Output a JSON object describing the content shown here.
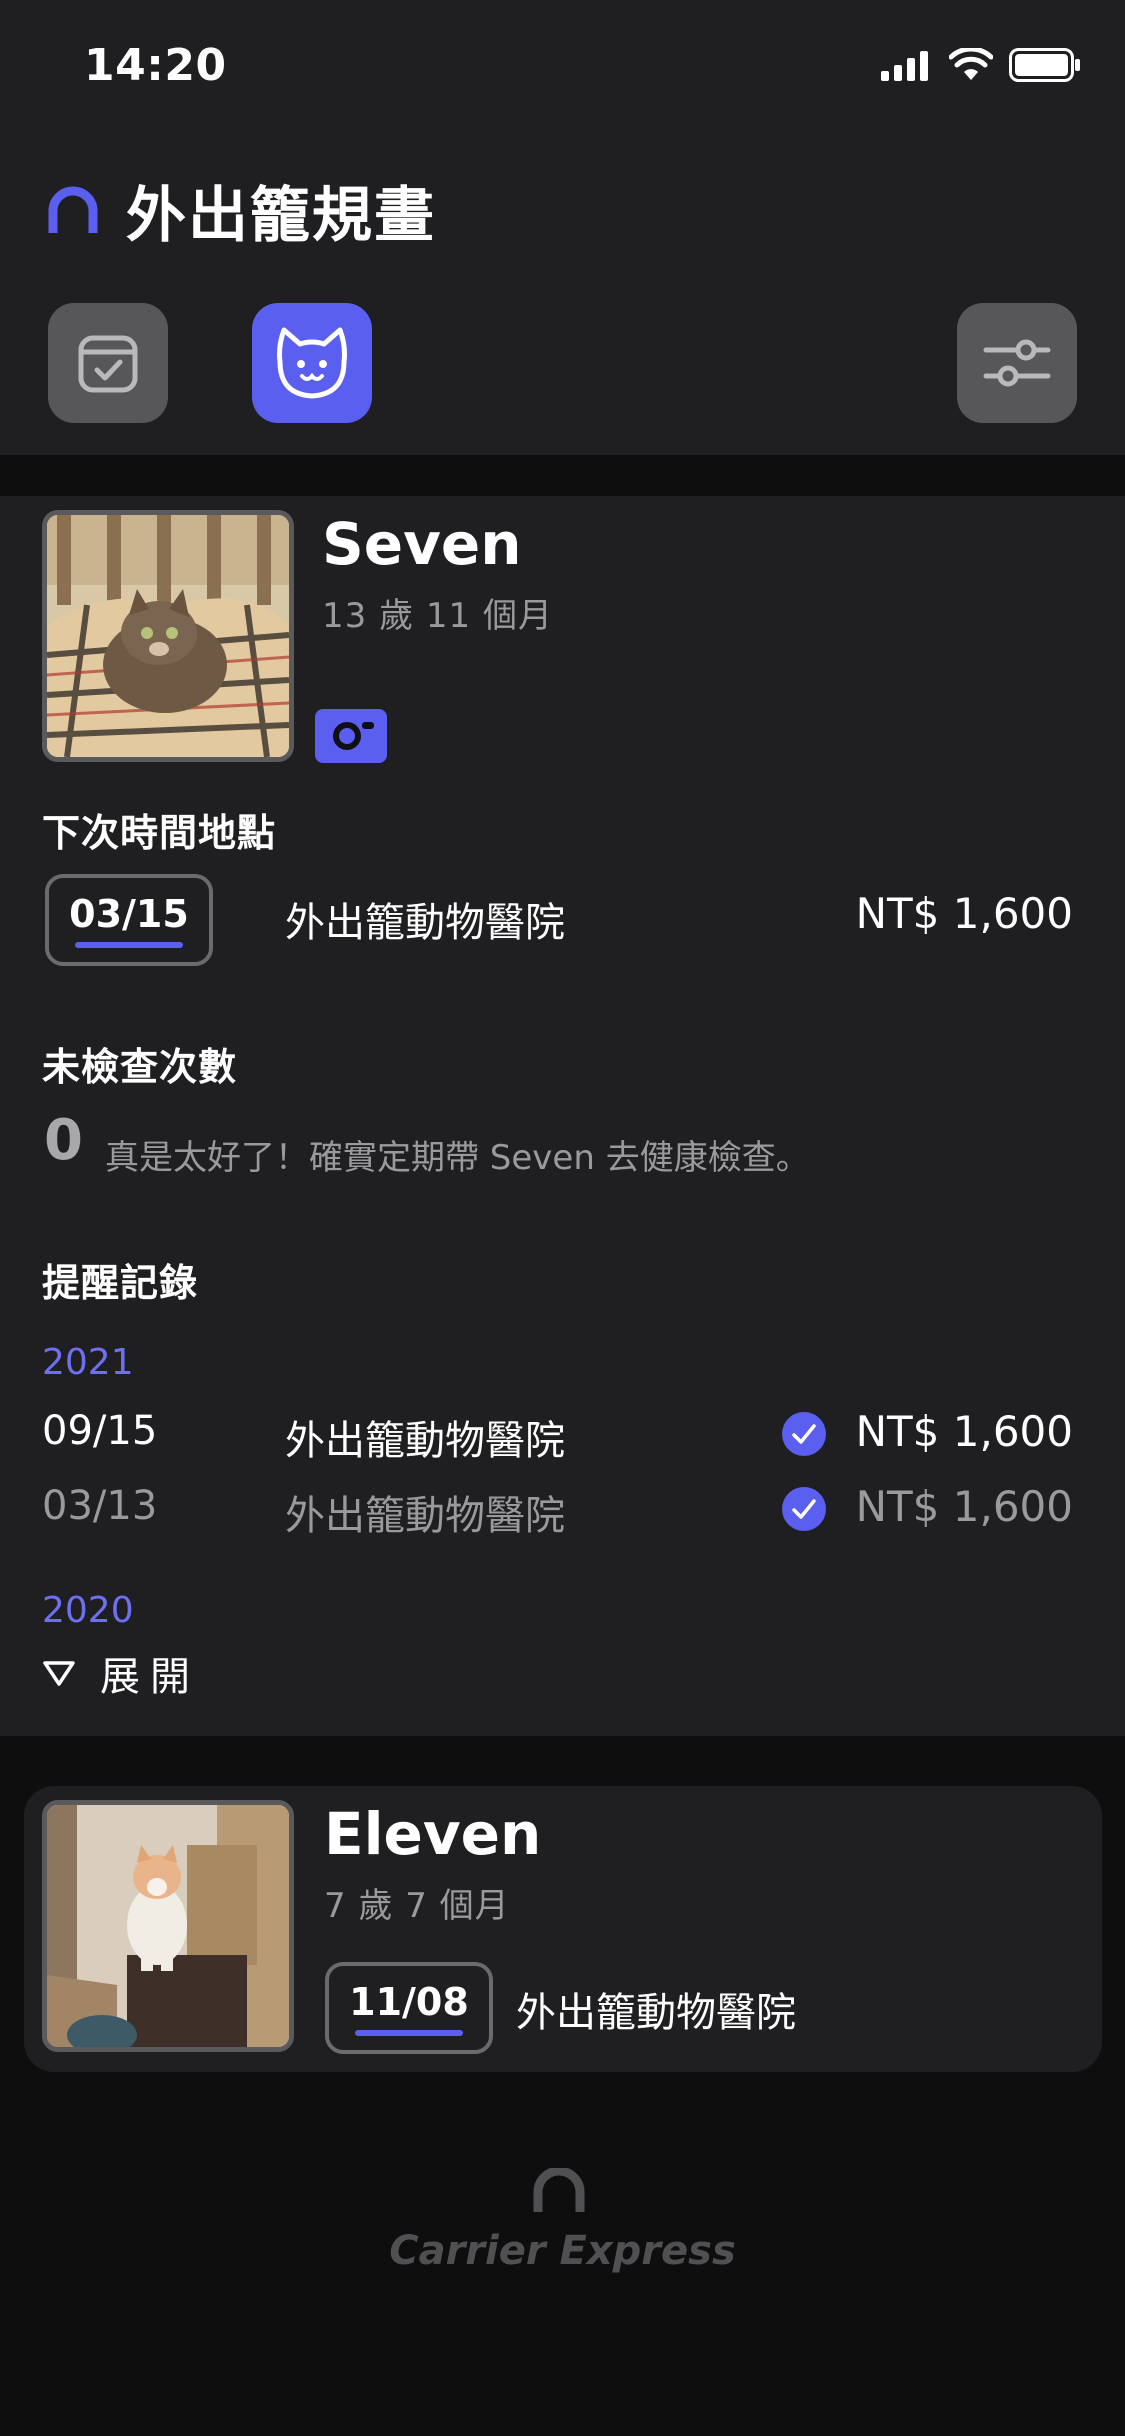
{
  "status_bar": {
    "time": "14:20"
  },
  "app": {
    "title": "外出籠規畫"
  },
  "tabs": [
    {
      "name": "schedule",
      "icon": "calendar-check-icon",
      "active": false
    },
    {
      "name": "pets",
      "icon": "cat-icon",
      "active": true
    },
    {
      "name": "settings",
      "icon": "sliders-icon",
      "active": false
    }
  ],
  "pets": [
    {
      "name": "Seven",
      "age": "13 歲 11 個月",
      "next_section_title": "下次時間地點",
      "next": {
        "date": "03/15",
        "place": "外出籠動物醫院",
        "price": "NT$ 1,600"
      },
      "unchecked_title": "未檢查次數",
      "unchecked_count": "0",
      "unchecked_message": "真是太好了！確實定期帶 Seven 去健康檢查。",
      "history_title": "提醒記錄",
      "history": [
        {
          "year": "2021",
          "records": [
            {
              "date": "09/15",
              "place": "外出籠動物醫院",
              "price": "NT$ 1,600",
              "checked": true
            },
            {
              "date": "03/13",
              "place": "外出籠動物醫院",
              "price": "NT$ 1,600",
              "checked": true
            }
          ]
        },
        {
          "year": "2020",
          "collapsed": true,
          "expand_label": "展開"
        }
      ]
    },
    {
      "name": "Eleven",
      "age": "7 歲 7 個月",
      "next": {
        "date": "11/08",
        "place": "外出籠動物醫院"
      }
    }
  ],
  "footer": {
    "brand": "Carrier Express"
  },
  "colors": {
    "accent": "#5a5ff0",
    "background": "#0e0e0f",
    "card": "#1f1f21",
    "muted": "#9a9a9e"
  }
}
